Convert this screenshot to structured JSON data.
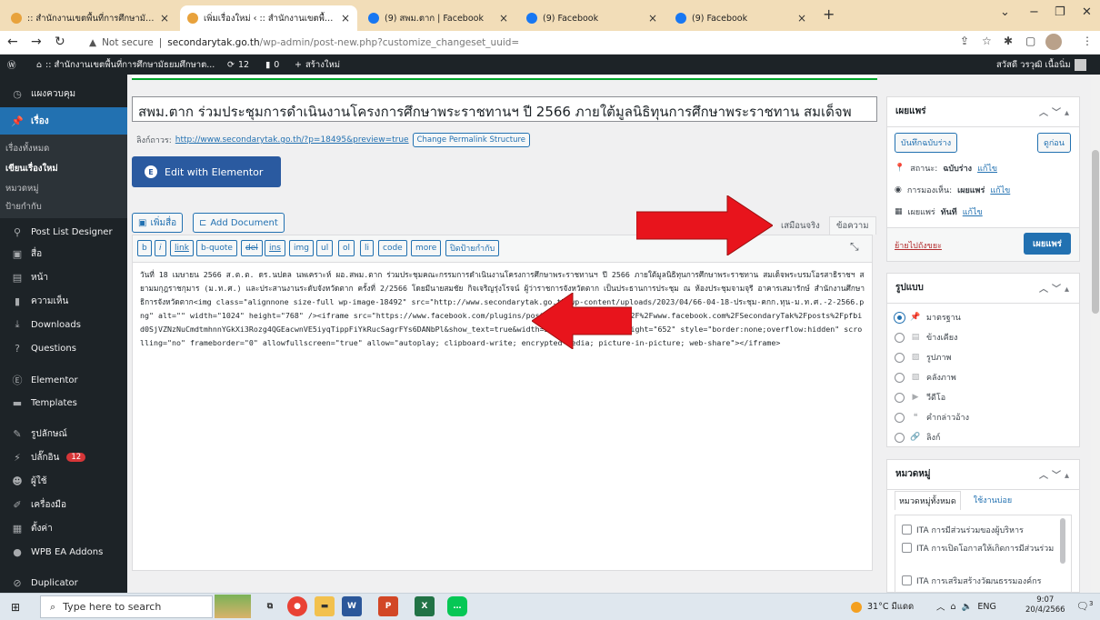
{
  "browser": {
    "tabs": [
      {
        "title": ":: สำนักงานเขตพื้นที่การศึกษามัธยมศึกษา",
        "favicon": "wp-icon"
      },
      {
        "title": "เพิ่มเรื่องใหม่ ‹ :: สำนักงานเขตพื้นที่การศึกษา",
        "favicon": "wp-icon"
      },
      {
        "title": "(9) สพม.ตาก | Facebook",
        "favicon": "facebook-icon"
      },
      {
        "title": "(9) Facebook",
        "favicon": "facebook-icon"
      },
      {
        "title": "(9) Facebook",
        "favicon": "facebook-icon"
      }
    ],
    "tab_close": "×",
    "new_tab": "+",
    "address": {
      "security": "Not secure",
      "host": "secondarytak.go.th",
      "path": "/wp-admin/post-new.php?customize_changeset_uuid="
    }
  },
  "adminbar": {
    "site": ":: สำนักงานเขตพื้นที่การศึกษามัธยมศึกษาต...",
    "updates": "12",
    "comments": "0",
    "new": "สร้างใหม่",
    "greeting": "สวัสดี วรวุฒิ เนื้อนิ่ม"
  },
  "sidebar": {
    "items": [
      {
        "label": "แผงควบคุม",
        "icon": "dashboard-icon"
      },
      {
        "label": "เรื่อง",
        "icon": "pin-icon"
      },
      {
        "label": "Post List Designer",
        "icon": "post-list-icon"
      },
      {
        "label": "สื่อ",
        "icon": "media-icon"
      },
      {
        "label": "หน้า",
        "icon": "page-icon"
      },
      {
        "label": "ความเห็น",
        "icon": "comment-icon"
      },
      {
        "label": "Downloads",
        "icon": "download-icon"
      },
      {
        "label": "Questions",
        "icon": "question-icon"
      },
      {
        "label": "Elementor",
        "icon": "elementor-icon"
      },
      {
        "label": "Templates",
        "icon": "folder-icon"
      },
      {
        "label": "รูปลักษณ์",
        "icon": "appearance-icon"
      },
      {
        "label": "ปลั๊กอิน",
        "icon": "plugin-icon",
        "badge": "12"
      },
      {
        "label": "ผู้ใช้",
        "icon": "users-icon"
      },
      {
        "label": "เครื่องมือ",
        "icon": "tools-icon"
      },
      {
        "label": "ตั้งค่า",
        "icon": "settings-icon"
      },
      {
        "label": "WPB EA Addons",
        "icon": "addons-icon"
      },
      {
        "label": "Duplicator",
        "icon": "duplicator-icon"
      }
    ],
    "submenu": [
      "เรื่องทั้งหมด",
      "เขียนเรื่องใหม่",
      "หมวดหมู่",
      "ป้ายกำกับ"
    ]
  },
  "editor": {
    "title": "สพม.ตาก ร่วมประชุมการดำเนินงานโครงการศึกษาพระราชทานฯ ปี 2566 ภายใต้มูลนิธิทุนการศึกษาพระราชทาน สมเด็จพ",
    "permalink_label": "ลิงก์ถาวร:",
    "permalink_url": "http://www.secondarytak.go.th/?p=18495&preview=true",
    "change_permalink": "Change Permalink Structure",
    "elementor_button": "Edit with Elementor",
    "add_media": "เพิ่มสื่อ",
    "add_document": "Add Document",
    "tab_visual": "เสมือนจริง",
    "tab_text": "ข้อความ",
    "quicktags": [
      "b",
      "i",
      "link",
      "b-quote",
      "del",
      "ins",
      "img",
      "ul",
      "ol",
      "li",
      "code",
      "more",
      "ปิดป้ายกำกับ"
    ],
    "content": "วันที่ 18 เมษายน 2566 ส.ต.ต. ดร.นปดล นพเคราะห์ ผอ.สพม.ตาก ร่วมประชุมคณะกรรมการดำเนินงานโครงการศึกษาพระราชทานฯ ปี 2566 ภายใต้มูลนิธิทุนการศึกษาพระราชทาน สมเด็จพระบรมโอรสาธิราชฯ สยามมกุฎราชกุมาร (ม.ท.ศ.) และประสานงานระดับจังหวัดตาก ครั้งที่ 2/2566 โดยมีนายสมชัย กิจเจริญรุ่งโรจน์ ผู้ว่าราชการจังหวัดตาก เป็นประธานการประชุม ณ ห้องประชุมจามจุรี อาคารเสมารักษ์ สำนักงานศึกษาธิการจังหวัดตาก<img class=\"alignnone size-full wp-image-18492\" src=\"http://www.secondarytak.go.th/wp-content/uploads/2023/04/66-04-18-ประชุม-คกก.ทุน-ม.ท.ศ.-2-2566.png\" alt=\"\" width=\"1024\" height=\"768\" /><iframe src=\"https://www.facebook.com/plugins/post.php?href=https%3A%2F%2Fwww.facebook.com%2FSecondaryTak%2Fposts%2Fpfbid0SjVZNzNuCmdtmhnnYGkXi3Rozg4QGEacwnVE5iyqTippFiYkRucSagrFYs6DANbPl&show_text=true&width=500\" width=\"500\" height=\"652\" style=\"border:none;overflow:hidden\" scrolling=\"no\" frameborder=\"0\" allowfullscreen=\"true\" allow=\"autoplay; clipboard-write; encrypted-media; picture-in-picture; web-share\"></iframe>"
  },
  "publish": {
    "heading": "เผยแพร่",
    "save_draft": "บันทึกฉบับร่าง",
    "preview": "ดูก่อน",
    "status_label": "สถานะ:",
    "status_value": "ฉบับร่าง",
    "visibility_label": "การมองเห็น:",
    "visibility_value": "เผยแพร่",
    "schedule_label": "เผยแพร่",
    "schedule_value": "ทันที",
    "edit": "แก้ไข",
    "trash": "ย้ายไปถังขยะ",
    "publish_button": "เผยแพร่"
  },
  "format": {
    "heading": "รูปแบบ",
    "options": [
      {
        "label": "มาตรฐาน",
        "icon": "pin-icon",
        "selected": true
      },
      {
        "label": "ข้างเคียง",
        "icon": "aside-icon",
        "selected": false
      },
      {
        "label": "รูปภาพ",
        "icon": "image-icon",
        "selected": false
      },
      {
        "label": "คลังภาพ",
        "icon": "gallery-icon",
        "selected": false
      },
      {
        "label": "วีดีโอ",
        "icon": "video-icon",
        "selected": false
      },
      {
        "label": "คำกล่าวอ้าง",
        "icon": "quote-icon",
        "selected": false
      },
      {
        "label": "ลิงก์",
        "icon": "link-icon",
        "selected": false
      }
    ]
  },
  "categories": {
    "heading": "หมวดหมู่",
    "tab_all": "หมวดหมู่ทั้งหมด",
    "tab_popular": "ใช้งานบ่อย",
    "items": [
      "ITA การมีส่วนร่วมของผู้บริหาร",
      "ITA การเปิดโอกาสให้เกิดการมีส่วนร่วม",
      "ITA การเสริมสร้างวัฒนธรรมองค์กร"
    ]
  },
  "taskbar": {
    "search_placeholder": "Type here to search",
    "weather": "31°C มีแดด",
    "lang": "ENG",
    "time": "9:07",
    "date": "20/4/2566",
    "notifications": "3"
  },
  "colors": {
    "accent": "#2271b1",
    "admin_dark": "#1d2327",
    "arrow": "#e8141c"
  }
}
